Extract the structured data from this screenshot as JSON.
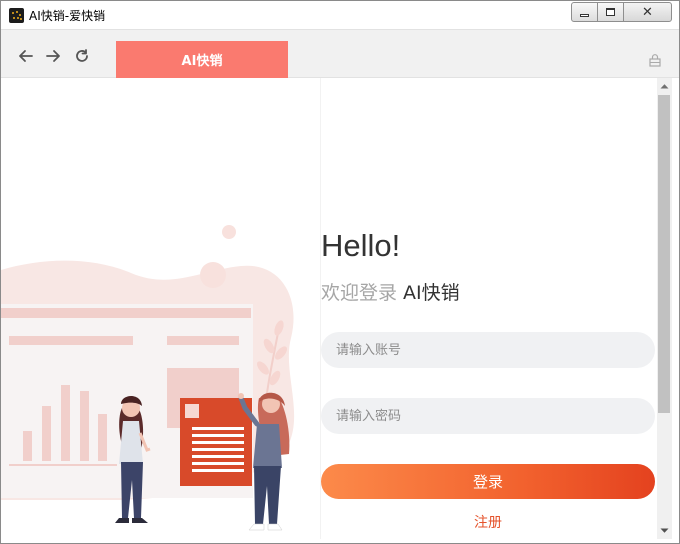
{
  "window": {
    "title": "AI快销-爱快销",
    "icon": "app-logo-icon",
    "controls": [
      "minimize-icon",
      "maximize-icon",
      "close-icon"
    ]
  },
  "toolbar": {
    "back_icon": "arrow-left-icon",
    "forward_icon": "arrow-right-icon",
    "reload_icon": "reload-icon",
    "tab_label": "AI快销",
    "tab_color": "#fa7a6f",
    "right_icon": "lock-icon"
  },
  "login": {
    "greeting": "Hello!",
    "subtitle_prefix": "欢迎登录",
    "subtitle_brand": " AI快销",
    "account_placeholder": "请输入账号",
    "account_value": "",
    "password_placeholder": "请输入密码",
    "password_value": "",
    "login_label": "登录",
    "register_label": "注册",
    "accent_color": "#f2622e",
    "register_color": "#e5532c"
  }
}
